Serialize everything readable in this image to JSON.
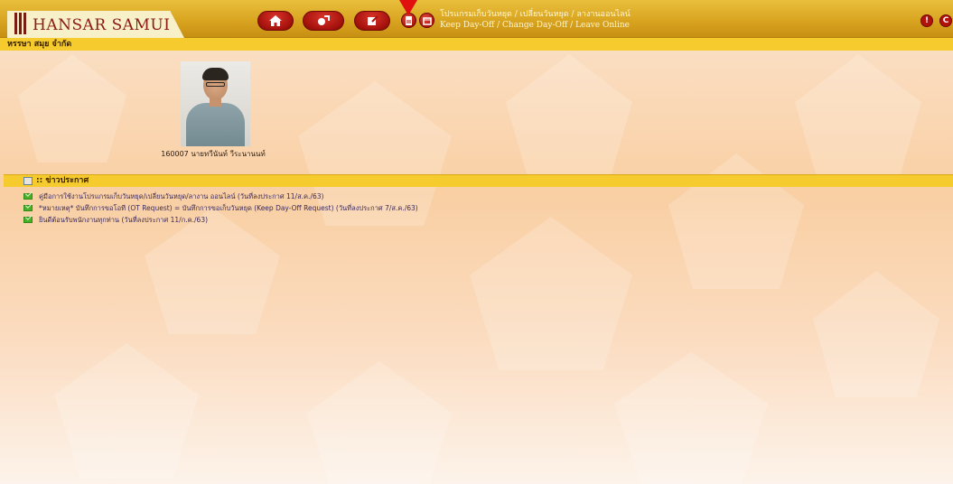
{
  "header": {
    "logo_text": "HANSAR SAMUI",
    "nav_buttons": [
      {
        "icon": "home-icon"
      },
      {
        "icon": "swap-icon"
      },
      {
        "icon": "edit-icon"
      }
    ],
    "small_icons": [
      {
        "icon": "document-icon"
      },
      {
        "icon": "calendar-icon"
      }
    ],
    "menu_title_th": "โปรแกรมเก็บวันหยุด / เปลี่ยนวันหยุด / ลางานออนไลน์",
    "menu_title_en": "Keep Day-Off / Change Day-Off / Leave Online",
    "right_icons": [
      {
        "icon": "info-icon",
        "glyph": "!"
      },
      {
        "icon": "logout-icon",
        "glyph": "C"
      }
    ]
  },
  "company": {
    "name": "หรรษา สมุย จำกัด"
  },
  "profile": {
    "employee": "160007 นายทวีนันท์ วีระนานนท์"
  },
  "news": {
    "title": ":: ข่าวประกาศ",
    "items": [
      "คู่มือการใช้งานโปรแกรมเก็บวันหยุด/เปลี่ยนวันหยุด/ลางาน ออนไลน์ (วันที่ลงประกาศ 11/ส.ค./63)",
      "*หมายเหตุ* บันทึกการขอโอที (OT Request) = บันทึกการขอเก็บวันหยุด (Keep Day-Off Request) (วันที่ลงประกาศ 7/ส.ค./63)",
      "ยินดีต้อนรับพนักงานทุกท่าน (วันที่ลงประกาศ 11/ก.ค./63)"
    ]
  },
  "colors": {
    "header_gold": "#d9a521",
    "bar_yellow": "#f6cb2d",
    "button_red": "#a5120c",
    "pointer_red": "#e01010"
  }
}
